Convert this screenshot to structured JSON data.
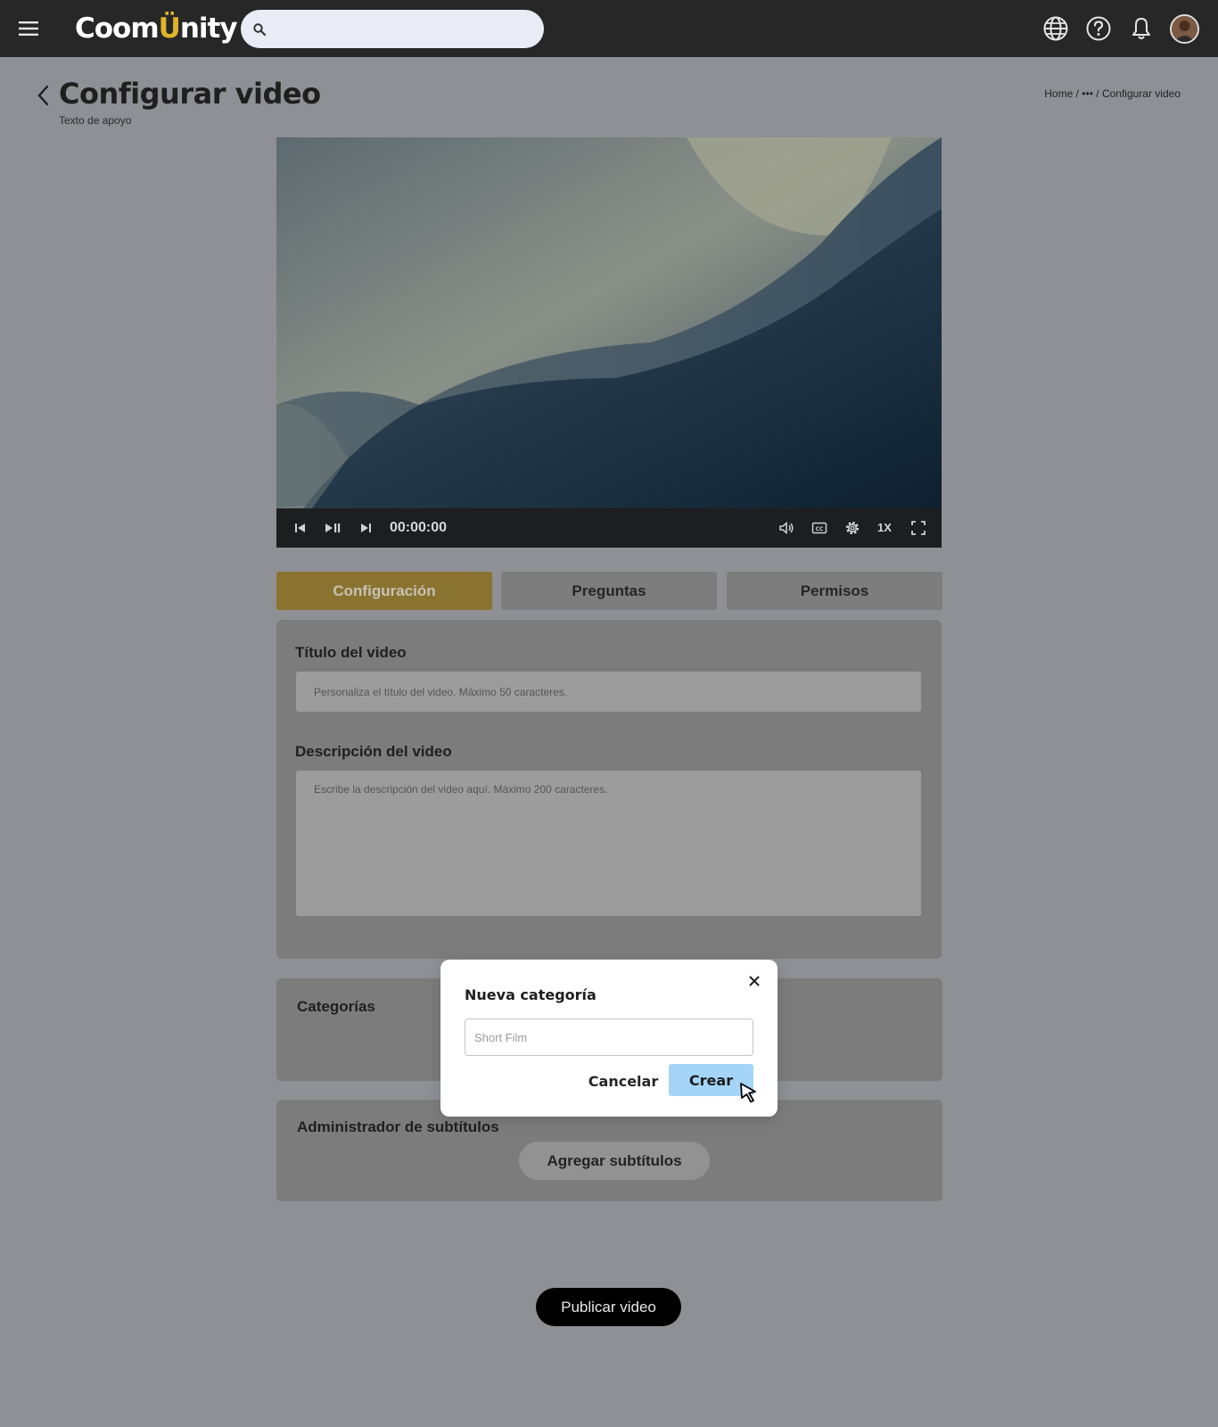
{
  "app": {
    "logo_left": "Coom",
    "logo_y": "Ü",
    "logo_right": "nity",
    "search": {
      "value": "",
      "placeholder": ""
    }
  },
  "icons": {
    "menu": "hamburger-icon",
    "search": "search-icon",
    "language": "globe-icon",
    "help": "help-icon",
    "notifications": "bell-icon",
    "back": "chevron-left-icon"
  },
  "page": {
    "title": "Configurar video",
    "subtitle": "Texto de apoyo",
    "breadcrumb": [
      "Home",
      "•••",
      "Configurar video"
    ]
  },
  "video": {
    "time": "00:00:00",
    "speed": "1X"
  },
  "tabs": [
    {
      "label": "Configuración",
      "active": true
    },
    {
      "label": "Preguntas",
      "active": false
    },
    {
      "label": "Permisos",
      "active": false
    }
  ],
  "form": {
    "title_label": "Título del video",
    "title_placeholder": "Personaliza el título del video. Máximo 50 caracteres.",
    "desc_label": "Descripción del video",
    "desc_placeholder": "Escribe la descripción del video aquí. Máximo 200 caracteres."
  },
  "categories": {
    "label": "Categorías"
  },
  "subtitles": {
    "label": "Administrador de subtítulos",
    "button": "Agregar subtítulos"
  },
  "publish_label": "Publicar video",
  "modal": {
    "title": "Nueva categoría",
    "input_placeholder": "Short Film",
    "cancel_label": "Cancelar",
    "create_label": "Crear"
  },
  "colors": {
    "topbar": "#272727",
    "brand_yellow": "#e0b32a",
    "active_tab": "#8a7330",
    "create_button": "#a4d4f8",
    "overlay_bg": "#8f9095"
  }
}
